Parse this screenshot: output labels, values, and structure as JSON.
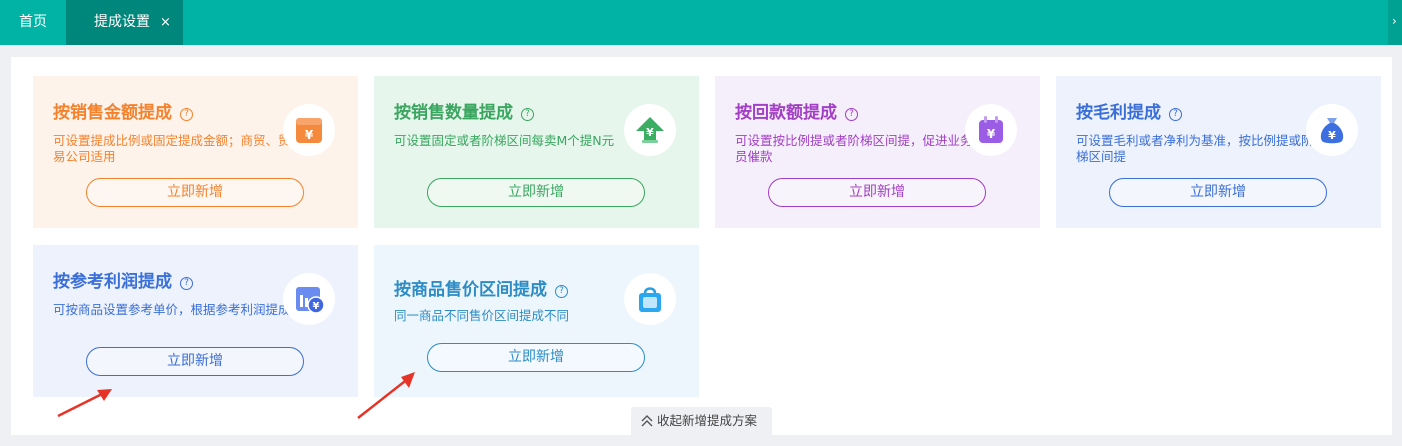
{
  "tabs": {
    "home": "首页",
    "active": "提成设置",
    "close": "×",
    "overflow": "›"
  },
  "cards": [
    {
      "title": "按销售金额提成",
      "desc": "可设置提成比例或固定提成金额；商贸、贸易公司适用",
      "button": "立即新增",
      "icon": "wallet-yen-icon"
    },
    {
      "title": "按销售数量提成",
      "desc": "可设置固定或者阶梯区间每卖M个提N元",
      "button": "立即新增",
      "icon": "yen-upload-icon"
    },
    {
      "title": "按回款额提成",
      "desc": "可设置按比例提或者阶梯区间提，促进业务员催款",
      "button": "立即新增",
      "icon": "calendar-yen-icon"
    },
    {
      "title": "按毛利提成",
      "desc": "可设置毛利或者净利为基准，按比例提或阶梯区间提",
      "button": "立即新增",
      "icon": "money-bag-icon"
    },
    {
      "title": "按参考利润提成",
      "desc": "可按商品设置参考单价，根据参考利润提成",
      "button": "立即新增",
      "icon": "chart-yen-icon"
    },
    {
      "title": "按商品售价区间提成",
      "desc": "同一商品不同售价区间提成不同",
      "button": "立即新增",
      "icon": "shopping-bag-icon"
    }
  ],
  "colors": {
    "tabbar": "#00b3a5",
    "tab_active": "#00877b",
    "orange": "#f4822d",
    "green": "#3aa660",
    "purple": "#a23fc4",
    "blue": "#3b6fd8",
    "teal_blue": "#2d8cc4"
  },
  "collapse_label": "收起新增提成方案"
}
